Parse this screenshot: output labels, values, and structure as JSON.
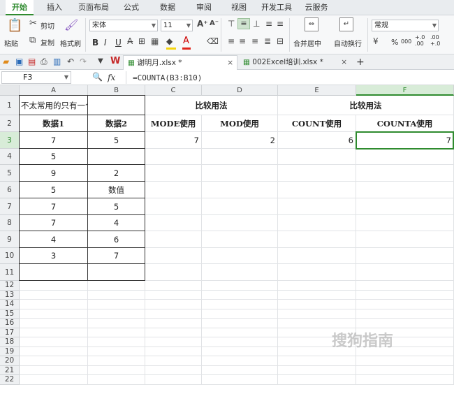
{
  "menu": {
    "tabs": [
      "开始",
      "插入",
      "页面布局",
      "公式",
      "数据",
      "审阅",
      "视图",
      "开发工具",
      "云服务"
    ],
    "active_index": 0
  },
  "ribbon": {
    "paste": "粘贴",
    "cut": "剪切",
    "copy": "复制",
    "format_painter": "格式刷",
    "font_name": "宋体",
    "font_size": "11",
    "bold": "B",
    "italic": "I",
    "underline": "U",
    "merge_center": "合并居中",
    "wrap_text": "自动换行",
    "number_format": "常规",
    "percent": "%",
    "comma": "000",
    "inc_decimal": "+.0 .00",
    "dec_decimal": ".00 +.0"
  },
  "tabs": {
    "doc1": "谢明月.xlsx *",
    "doc2": "002Excel培训.xlsx *",
    "close": "×",
    "add": "+"
  },
  "formula_bar": {
    "name_box": "F3",
    "fx": "fx",
    "formula": "=COUNTA(B3:B10)"
  },
  "sheet": {
    "columns": [
      "A",
      "B",
      "C",
      "D",
      "E",
      "F"
    ],
    "rows": [
      "1",
      "2",
      "3",
      "4",
      "5",
      "6",
      "7",
      "8",
      "9",
      "10",
      "11",
      "12",
      "13",
      "14",
      "15",
      "16",
      "17",
      "18",
      "19",
      "20",
      "21",
      "22"
    ],
    "a1": "不太常用的只有一个参数的函数",
    "c1_merged": "比较用法",
    "e1_merged": "比较用法",
    "headers": {
      "a2": "数据1",
      "b2": "数据2",
      "c2": "MODE使用",
      "d2": "MOD使用",
      "e2": "COUNT使用",
      "f2": "COUNTA使用"
    },
    "data1": [
      "7",
      "5",
      "9",
      "5",
      "7",
      "7",
      "4",
      "3"
    ],
    "data2": [
      "5",
      "",
      "2",
      "数值",
      "5",
      "4",
      "6",
      "7"
    ],
    "results": {
      "c3": "7",
      "d3": "2",
      "e3": "6",
      "f3": "7"
    },
    "active_cell": "F3"
  },
  "watermark": "搜狗指南"
}
